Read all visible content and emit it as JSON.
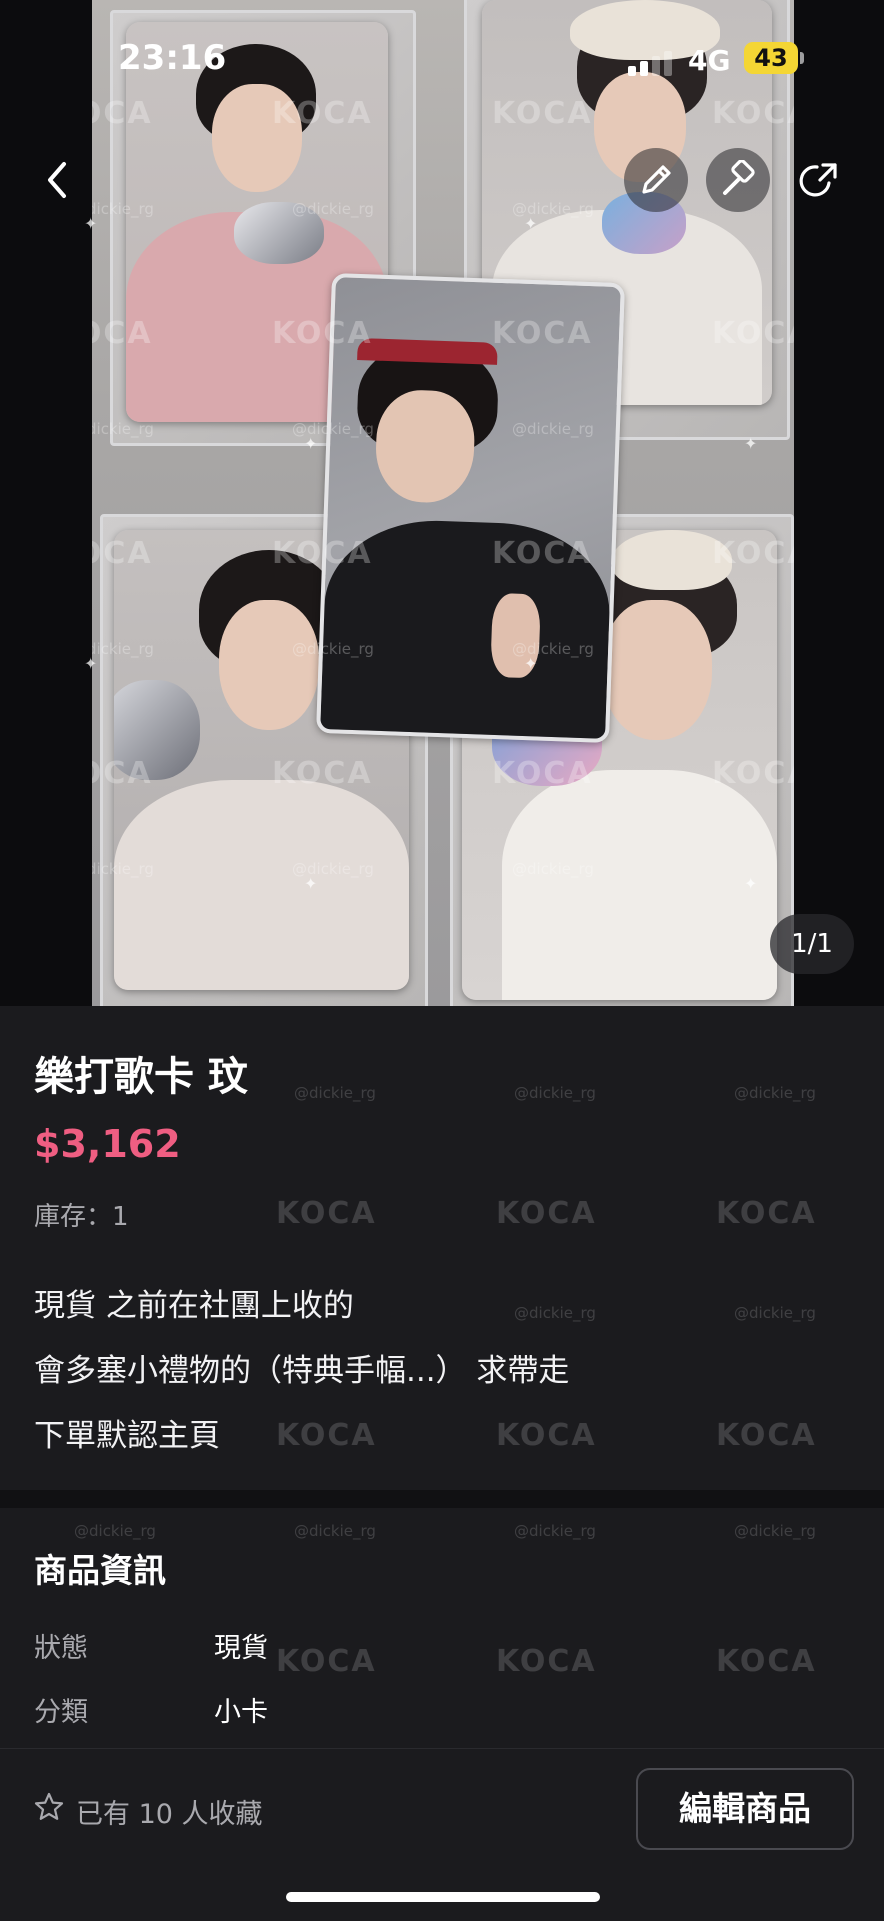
{
  "status_bar": {
    "time": "23:16",
    "network": "4G",
    "battery": "43"
  },
  "gallery": {
    "page_indicator": "1/1",
    "watermark_text": "KOCA",
    "watermark_handle": "@dickie_rg"
  },
  "product": {
    "title": "樂打歌卡 玟",
    "price": "$3,162",
    "stock": "庫存：1",
    "description": [
      "現貨 之前在社團上收的",
      "會多塞小禮物的（特典手幅...） 求帶走",
      "下單默認主頁"
    ]
  },
  "details": {
    "heading": "商品資訊",
    "rows": [
      {
        "label": "狀態",
        "value": "現貨"
      },
      {
        "label": "分類",
        "value": "小卡"
      }
    ]
  },
  "bottom_bar": {
    "favorites_text": "已有 10 人收藏",
    "edit_button_label": "編輯商品"
  },
  "icons": {
    "back": "chevron-left-icon",
    "edit": "pencil-icon",
    "auction": "hammer-icon",
    "share": "share-icon",
    "favorite": "star-icon"
  },
  "colors": {
    "price": "#ef5e82",
    "background": "#1b1b1e",
    "battery": "#f4d634"
  }
}
